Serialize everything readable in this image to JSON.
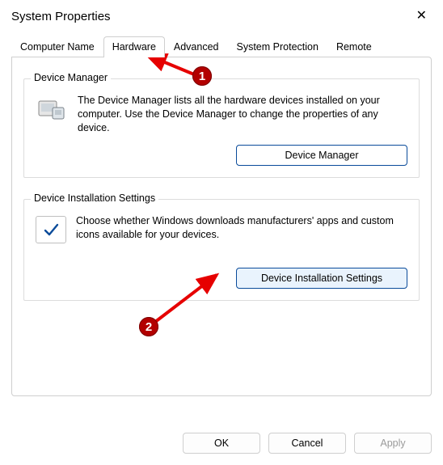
{
  "window": {
    "title": "System Properties"
  },
  "tabs": {
    "computer_name": "Computer Name",
    "hardware": "Hardware",
    "advanced": "Advanced",
    "system_protection": "System Protection",
    "remote": "Remote"
  },
  "device_manager": {
    "group_label": "Device Manager",
    "description": "The Device Manager lists all the hardware devices installed on your computer. Use the Device Manager to change the properties of any device.",
    "button": "Device Manager"
  },
  "device_install": {
    "group_label": "Device Installation Settings",
    "description": "Choose whether Windows downloads manufacturers' apps and custom icons available for your devices.",
    "button": "Device Installation Settings"
  },
  "footer": {
    "ok": "OK",
    "cancel": "Cancel",
    "apply": "Apply"
  },
  "annotations": {
    "step1": "1",
    "step2": "2"
  }
}
